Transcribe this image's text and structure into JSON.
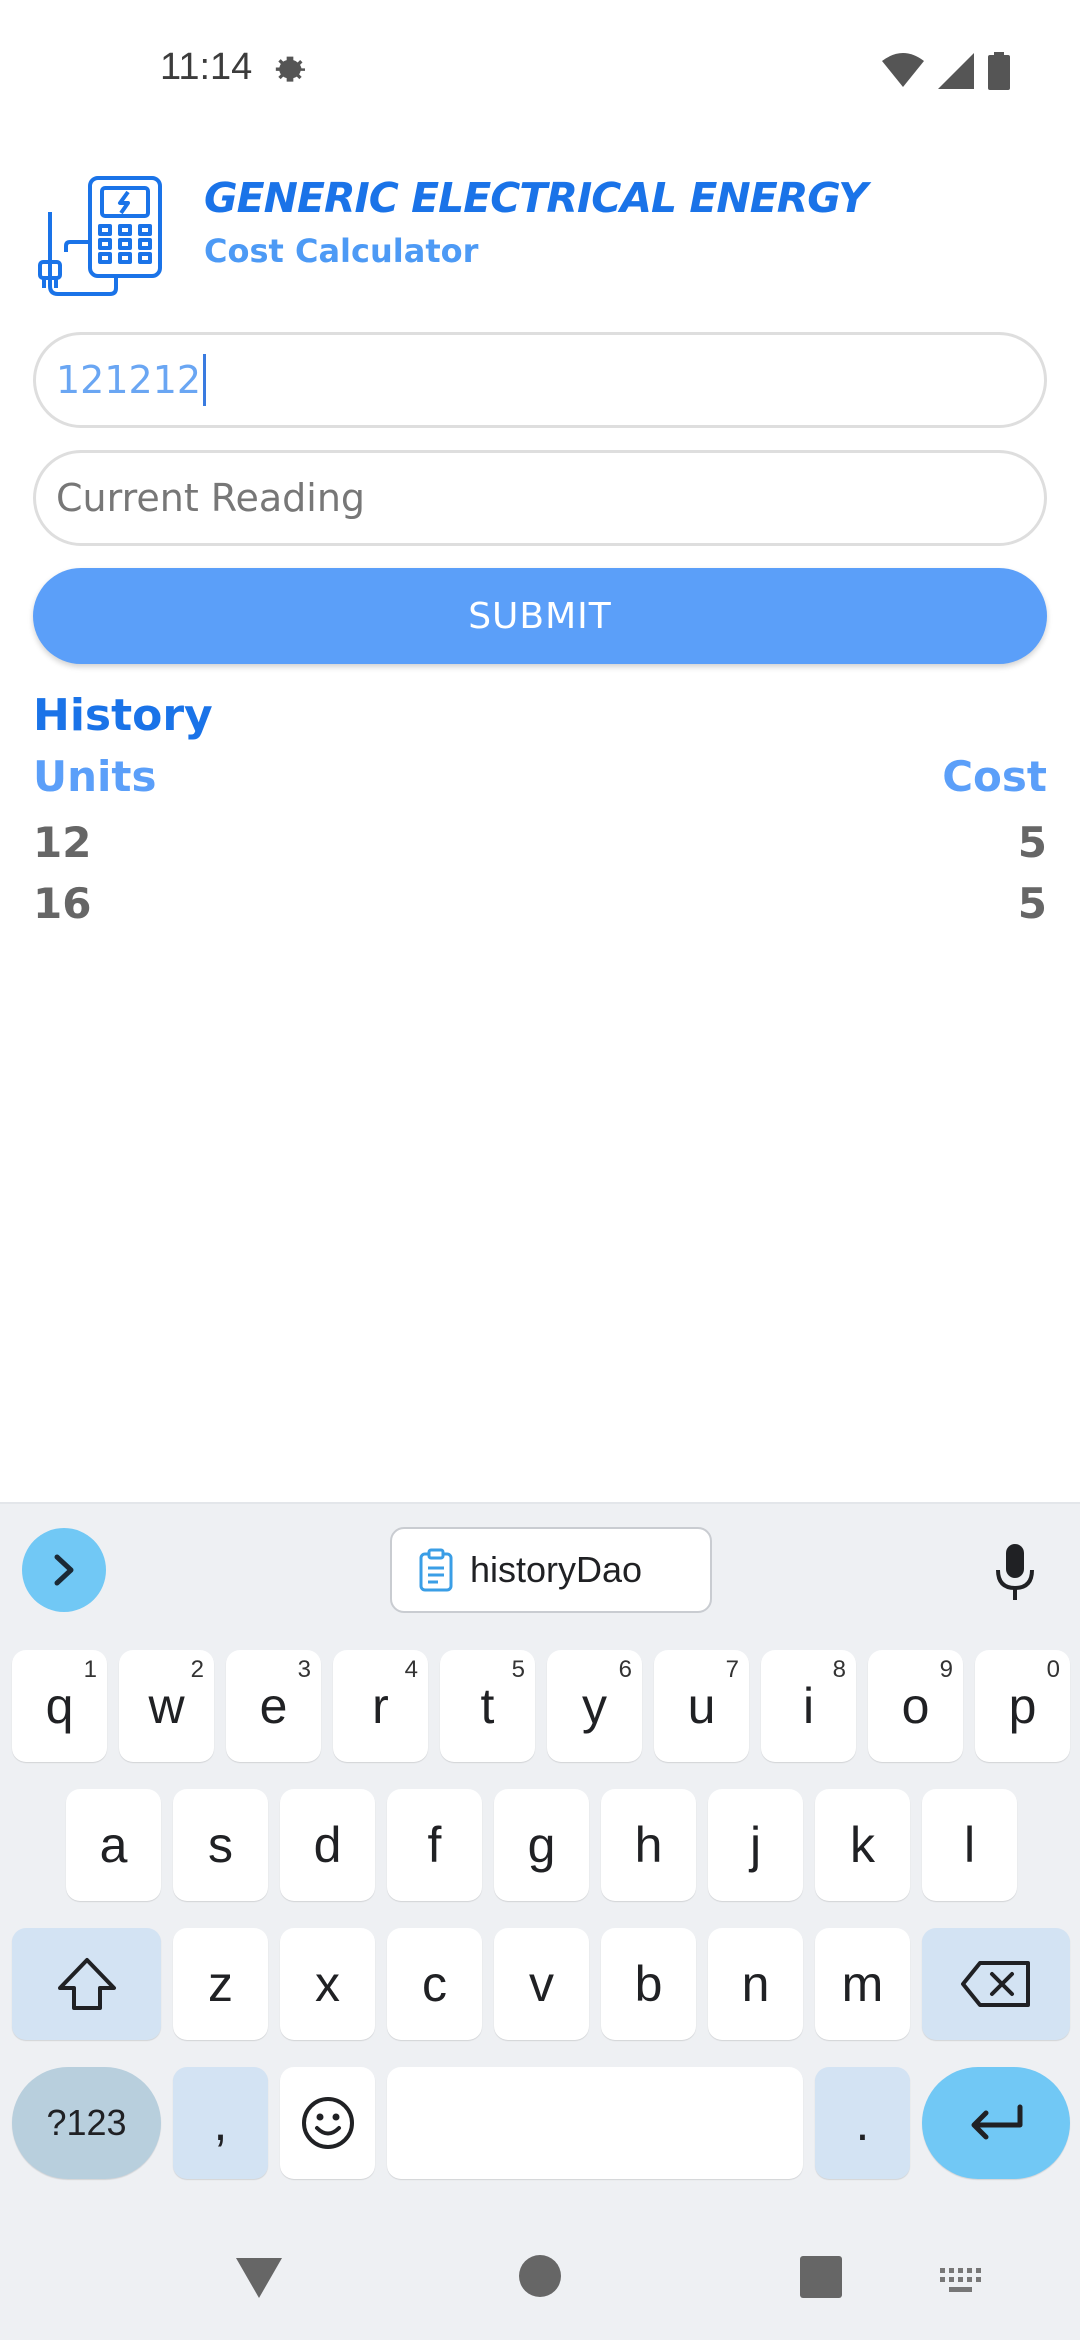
{
  "status_bar": {
    "time": "11:14",
    "icons": [
      "settings-icon",
      "wifi-icon",
      "signal-icon",
      "battery-icon"
    ]
  },
  "header": {
    "title": "GENERIC ELECTRICAL ENERGY",
    "subtitle": "Cost Calculator",
    "logo_icon": "electric-meter-icon"
  },
  "form": {
    "previous_reading_value": "121212",
    "current_reading_placeholder": "Current Reading",
    "submit_label": "SUBMIT"
  },
  "history": {
    "title": "History",
    "columns": [
      "Units",
      "Cost"
    ],
    "rows": [
      {
        "units": "12",
        "cost": "5"
      },
      {
        "units": "16",
        "cost": "5"
      }
    ]
  },
  "keyboard": {
    "clipboard_suggestion": "historyDao",
    "row1": [
      {
        "key": "q",
        "hint": "1"
      },
      {
        "key": "w",
        "hint": "2"
      },
      {
        "key": "e",
        "hint": "3"
      },
      {
        "key": "r",
        "hint": "4"
      },
      {
        "key": "t",
        "hint": "5"
      },
      {
        "key": "y",
        "hint": "6"
      },
      {
        "key": "u",
        "hint": "7"
      },
      {
        "key": "i",
        "hint": "8"
      },
      {
        "key": "o",
        "hint": "9"
      },
      {
        "key": "p",
        "hint": "0"
      }
    ],
    "row2": [
      "a",
      "s",
      "d",
      "f",
      "g",
      "h",
      "j",
      "k",
      "l"
    ],
    "row3": [
      "z",
      "x",
      "c",
      "v",
      "b",
      "n",
      "m"
    ],
    "symbols_label": "?123",
    "comma": ",",
    "period": "."
  },
  "colors": {
    "accent": "#1a73e8",
    "accent_light": "#5b9ff9",
    "keyboard_bg": "#eef0f3",
    "enter_key": "#71c8f5"
  }
}
